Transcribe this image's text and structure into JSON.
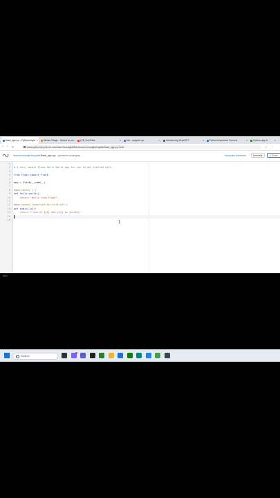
{
  "browser": {
    "tabs": [
      {
        "label": "flask_app.py : PythonAnyw",
        "active": true,
        "color": "#1f7bd1"
      },
      {
        "label": "Whats Stage - Select to ca",
        "active": false,
        "color": "#e08a1e"
      },
      {
        "label": "(74) YouTube",
        "active": false,
        "color": "#e53935"
      },
      {
        "label": "Ide - support.cp",
        "active": false,
        "color": "#5c6bc0"
      },
      {
        "label": "Introducing ChatGPT",
        "active": false,
        "color": "#455a64"
      },
      {
        "label": "PythonAnywhere Forums",
        "active": false,
        "color": "#1f7bd1"
      },
      {
        "label": "Python app fr",
        "active": false,
        "color": "#2e7d32"
      }
    ],
    "url": "www.pythonanywhere.com/user/mourajk4/files/home/mourajk4/mysite/flask_app.py?edit"
  },
  "header": {
    "breadcrumb": [
      "/home/mourajk4/mysite/",
      "flask_app.py"
    ],
    "unsaved": "(unsaved changes)",
    "keyboard_shortcuts": "Keyboard shortcuts",
    "theme": "Normal",
    "share": "Share"
  },
  "editor": {
    "lines": [
      {
        "n": "1",
        "text": ""
      },
      {
        "n": "2",
        "text": "# A very simple Flask Hello World app for you to get started with...",
        "cls": "c-comment"
      },
      {
        "n": "3",
        "text": ""
      },
      {
        "n": "4",
        "text": "from flask import Flask",
        "cls": "c-kw"
      },
      {
        "n": "5",
        "text": ""
      },
      {
        "n": "6",
        "text": "app = Flask(__name__)"
      },
      {
        "n": "7",
        "text": ""
      },
      {
        "n": "8",
        "text": "@app.route('/')",
        "cls": "c-dec"
      },
      {
        "n": "9",
        "text": "def hello_world():",
        "cls": "c-kw"
      },
      {
        "n": "10",
        "text": "    return 'Hello from Flask!'",
        "cls": "c-str"
      },
      {
        "n": "11",
        "text": ""
      },
      {
        "n": "12",
        "text": "@app.route('/sum/<int:n1>/<int:n2>')",
        "cls": "c-dec"
      },
      {
        "n": "13",
        "text": "def sum(n1,n2):",
        "cls": "c-kw"
      },
      {
        "n": "14",
        "text": "    return f'sum of {n1} and {n2} is {n1+n2}'",
        "cls": "c-str"
      },
      {
        "n": "15",
        "text": ""
      },
      {
        "n": "16",
        "text": ""
      }
    ],
    "active_line": 15
  },
  "console": {
    "title": ">>>"
  },
  "taskbar": {
    "search_placeholder": "Search",
    "notification_count": "1",
    "icons": [
      {
        "name": "task-view-icon",
        "color": "#333333"
      },
      {
        "name": "chat-icon",
        "color": "#7b61ff"
      },
      {
        "name": "teams-icon",
        "color": "#5b5fc7"
      },
      {
        "name": "media-icon",
        "color": "#222222"
      },
      {
        "name": "edge-icon",
        "color": "#2e7d32"
      },
      {
        "name": "file-explorer-icon",
        "color": "#f0b429"
      },
      {
        "name": "store-icon",
        "color": "#1a73d9"
      },
      {
        "name": "xbox-icon",
        "color": "#107c10"
      },
      {
        "name": "settings-icon",
        "color": "#00897b"
      },
      {
        "name": "browser-icon",
        "color": "#1e88e5"
      },
      {
        "name": "chrome-icon",
        "color": "#43a047"
      },
      {
        "name": "terminal-icon",
        "color": "#37474f"
      }
    ]
  },
  "colors": {
    "link": "#2b7bb9",
    "editor_bg": "#ffffff",
    "console_bg": "#000000"
  }
}
